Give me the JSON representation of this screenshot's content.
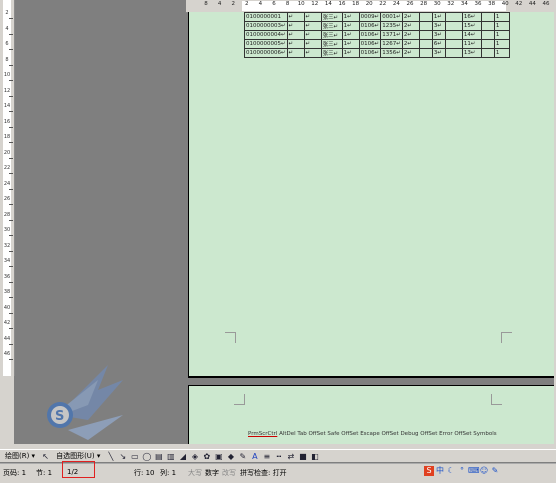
{
  "horizontal_ruler": {
    "numbers": [
      "8",
      "4",
      "2",
      "2",
      "4",
      "6",
      "8",
      "10",
      "12",
      "14",
      "16",
      "18",
      "20",
      "22",
      "24",
      "26",
      "28",
      "30",
      "32",
      "34",
      "36",
      "38",
      "40",
      "42",
      "44",
      "46"
    ]
  },
  "vertical_ruler": {
    "numbers": [
      "2",
      "4",
      "6",
      "8",
      "10",
      "12",
      "14",
      "16",
      "18",
      "20",
      "22",
      "24",
      "26",
      "28",
      "30",
      "32",
      "34",
      "36",
      "38",
      "40",
      "42",
      "44",
      "46"
    ]
  },
  "table": {
    "rows": [
      [
        "0100000001",
        "↵",
        "↵",
        "张三↵",
        "1↵",
        "0009↵",
        "0001↵",
        "2↵",
        "",
        "1↵",
        "",
        "16↵",
        "",
        "1"
      ],
      [
        "0100000003↵",
        "↵",
        "↵",
        "张三↵",
        "1↵",
        "0106↵",
        "1235↵",
        "2↵",
        "",
        "3↵",
        "",
        "15↵",
        "",
        "1"
      ],
      [
        "0100000004↵",
        "↵",
        "↵",
        "张三↵",
        "1↵",
        "0106↵",
        "1371↵",
        "2↵",
        "",
        "3↵",
        "",
        "14↵",
        "",
        "1"
      ],
      [
        "0100000005↵",
        "↵",
        "↵",
        "张三↵",
        "1↵",
        "0106↵",
        "1267↵",
        "2↵",
        "",
        "6↵",
        "",
        "11↵",
        "",
        "1"
      ],
      [
        "0100000006↵",
        "↵",
        "↵",
        "张三↵",
        "1↵",
        "0106↵",
        "1356↵",
        "2↵",
        "",
        "3↵",
        "",
        "13↵",
        "",
        "1"
      ]
    ]
  },
  "footer_keys": {
    "first": "PrmScrCtrl",
    "rest": "AltDel Tab OffSet Safe OffSet Escape OffSet Debug OffSet Error OffSet Symbols"
  },
  "draw_toolbar": {
    "draw_label": "绘图(R) ▾",
    "autoshape_label": "自选图形(U) ▾"
  },
  "status_bar": {
    "page": "页码: 1",
    "section": "节: 1",
    "page_of": "1/2",
    "at": "",
    "line": "行: 10",
    "col": "列: 1",
    "rec": "录制",
    "trk": "修订",
    "ext": "扩展",
    "ovr": "改写",
    "lang": "中文(中国)",
    "record_label": "大写",
    "num_label": "数字",
    "spell": "拼写检查: 打开"
  },
  "tray": {
    "ime_label": "中"
  },
  "colors": {
    "page_bg": "#cce8cf",
    "workspace": "#7f7f7f",
    "highlight": "#e02020"
  }
}
